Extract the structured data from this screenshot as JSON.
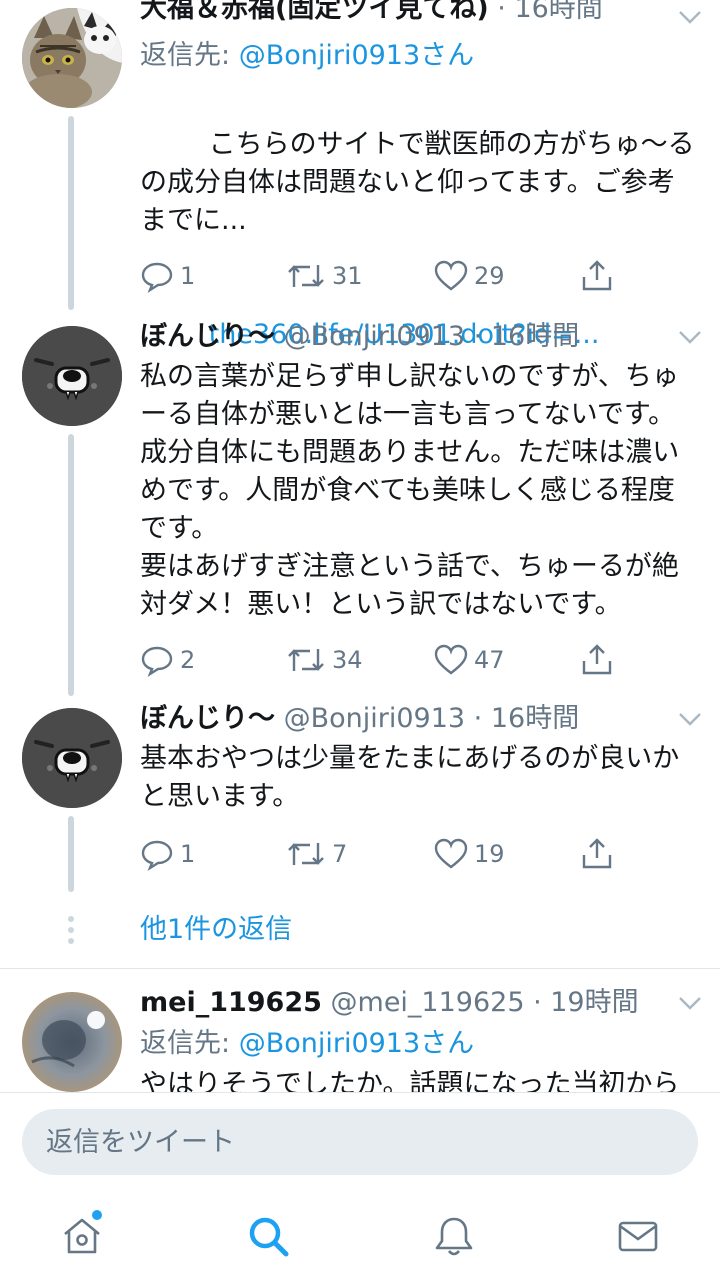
{
  "tweets": [
    {
      "name": "大福＆赤福(固定ツイ見てね)",
      "handle": "@Bonjiri0913",
      "meta": "· 16時間",
      "reply_prefix": "返信先: ",
      "reply_handle": "@Bonjiri0913さん",
      "text": "こちらのサイトで獣医師の方がちゅ〜るの成分自体は問題ないと仰ってます。ご参考までに...",
      "link": "the360.life/U1301.doit?id=...",
      "replies": "1",
      "retweets": "31",
      "likes": "29",
      "avatar": "cat-photo"
    },
    {
      "name": "ぼんじり〜",
      "handle": "@Bonjiri0913",
      "meta": "· 16時間",
      "text": "私の言葉が足らず申し訳ないのですが、ちゅーる自体が悪いとは一言も言ってないです。成分自体にも問題ありません。ただ味は濃いめです。人間が食べても美味しく感じる程度です。\n要はあげすぎ注意という話で、ちゅーるが絶対ダメ！悪い！という訳ではないです。",
      "replies": "2",
      "retweets": "34",
      "likes": "47",
      "avatar": "dog-face-illustration"
    },
    {
      "name": "ぼんじり〜",
      "handle": "@Bonjiri0913",
      "meta": "· 16時間",
      "text": "基本おやつは少量をたまにあげるのが良いかと思います。",
      "replies": "1",
      "retweets": "7",
      "likes": "19",
      "avatar": "dog-face-illustration"
    },
    {
      "name": "mei_119625",
      "handle": "@mei_119625",
      "meta": "· 19時間",
      "reply_prefix": "返信先: ",
      "reply_handle": "@Bonjiri0913さん",
      "text": "やはりそうでしたか。話題になった当初から",
      "avatar": "eye-photo"
    }
  ],
  "more_replies": "他1件の返信",
  "compose": {
    "placeholder": "返信をツイート"
  },
  "tabbar": {
    "items": [
      "home-icon",
      "search-icon",
      "notifications-icon",
      "messages-icon"
    ],
    "active": "search-icon"
  },
  "colors": {
    "accent": "#1da1f2",
    "link": "#1b95e0",
    "muted": "#657786",
    "thread_line": "#ccd6dd"
  }
}
